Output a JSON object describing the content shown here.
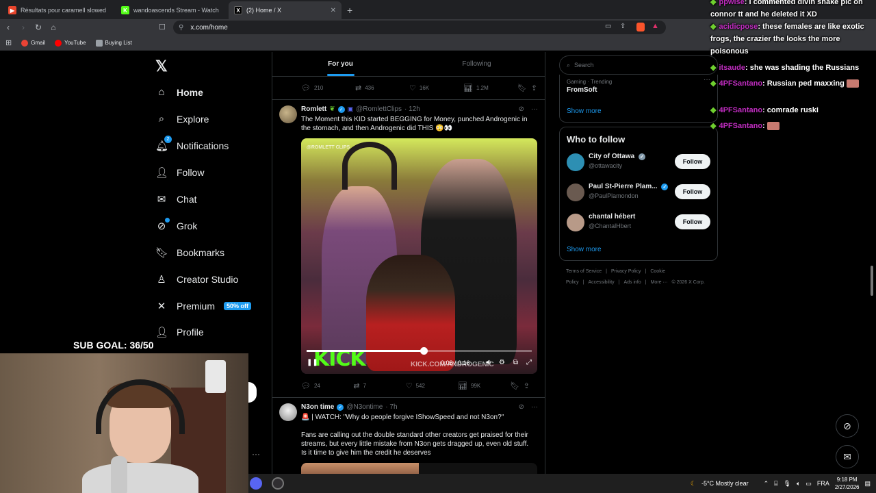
{
  "browser": {
    "tabs": [
      {
        "title": "Résultats pour caramell slowed reverb",
        "icon_color": "#e8452c",
        "icon": "youtube-icon",
        "active": false
      },
      {
        "title": "wandoascends Stream - Watch Live on Kick",
        "icon_color": "#53fc18",
        "icon": "kick-icon",
        "active": false
      },
      {
        "title": "(2) Home / X",
        "icon_color": "#000000",
        "icon": "x-icon",
        "active": true
      }
    ],
    "new_tab": "+",
    "url": "x.com/home",
    "bookmarks": [
      {
        "label": "Gmail",
        "color": "#ea4335"
      },
      {
        "label": "YouTube",
        "color": "#ff0000"
      },
      {
        "label": "Buying List",
        "color": "#9aa0a6"
      }
    ]
  },
  "nav": {
    "items": [
      {
        "label": "Home",
        "icon": "home-icon",
        "glyph": "⌂",
        "bold": true
      },
      {
        "label": "Explore",
        "icon": "search-icon",
        "glyph": "⌕"
      },
      {
        "label": "Notifications",
        "icon": "bell-icon",
        "glyph": "🔔︎",
        "badge": "2"
      },
      {
        "label": "Follow",
        "icon": "add-person-icon",
        "glyph": "👤︎"
      },
      {
        "label": "Chat",
        "icon": "mail-icon",
        "glyph": "✉"
      },
      {
        "label": "Grok",
        "icon": "grok-icon",
        "glyph": "⊘",
        "dot": true
      },
      {
        "label": "Bookmarks",
        "icon": "bookmark-icon",
        "glyph": "🔖︎"
      },
      {
        "label": "Creator Studio",
        "icon": "creator-icon",
        "glyph": "♙"
      },
      {
        "label": "Premium",
        "icon": "x-premium-icon",
        "glyph": "✕",
        "promo": "50% off"
      },
      {
        "label": "Profile",
        "icon": "profile-icon",
        "glyph": "👤︎"
      }
    ]
  },
  "timeline": {
    "tabs": [
      "For you",
      "Following"
    ],
    "prev_actions": {
      "replies": "210",
      "reposts": "436",
      "likes": "16K",
      "views": "1.2M"
    },
    "post1": {
      "name": "Romlett",
      "handle": "@RomlettClips",
      "time": "· 12h",
      "text": "The Moment this KID started BEGGING for Money, punched Androgenic in the stomach, and then Androgenic did THIS 😳👀",
      "video": {
        "watermark": "@ROMLETT CLIPS",
        "logo": "KICK",
        "url_overlay": "KICK.COM/ANDROGENIC",
        "time": "0:08 / 0:16",
        "progress": 0.52
      },
      "actions": {
        "replies": "24",
        "reposts": "7",
        "likes": "542",
        "views": "99K"
      }
    },
    "post2": {
      "name": "N3on time",
      "handle": "@N3ontime",
      "time": "· 7h",
      "line1": "🚨 | WATCH: \"Why do people forgive IShowSpeed and not N3on?\"",
      "line2": "Fans are calling out the double standard other creators get praised for their streams, but every little mistake from N3on gets dragged up, even old stuff. Is it time to give him the credit he deserves"
    }
  },
  "sidebar": {
    "search_placeholder": "Search",
    "trend": {
      "meta": "Gaming · Trending",
      "name": "FromSoft"
    },
    "show_more": "Show more",
    "wtf_title": "Who to follow",
    "follow_label": "Follow",
    "who_to_follow": [
      {
        "name": "City of Ottawa",
        "handle": "@ottawacity",
        "verified_color": "#829aab",
        "avatar_color": "#2d8fb3"
      },
      {
        "name": "Paul St-Pierre Plam...",
        "handle": "@PaulPlamondon",
        "verified_color": "#1d9bf0",
        "avatar_color": "#6a5a50"
      },
      {
        "name": "chantal hébert",
        "handle": "@ChantalHbert",
        "verified_color": null,
        "avatar_color": "#b89a88"
      }
    ],
    "footer": [
      "Terms of Service",
      "|",
      "Privacy Policy",
      "|",
      "Cookie Policy",
      "|",
      "Accessibility",
      "|",
      "Ads info",
      "|",
      "More ···",
      "© 2026 X Corp."
    ]
  },
  "stream_overlay": {
    "chat": [
      {
        "user": "ppwise",
        "msg": ": I commented divin snake pic on connor tt and he deleted it XD"
      },
      {
        "user": "acidicpose",
        "msg": ": these females are like exotic frogs, the crazier the looks the more poisonous"
      },
      {
        "user": "itsaude",
        "msg": ": she was shading the Russians"
      },
      {
        "user": "4PFSantano",
        "msg": ": Russian ped maxxing"
      },
      {
        "user": "4PFSantano",
        "msg": ": comrade ruski"
      },
      {
        "user": "4PFSantano",
        "msg": ":"
      }
    ],
    "sub_goal": "SUB GOAL: 36/50"
  },
  "taskbar": {
    "weather": "-5°C  Mostly clear",
    "lang": "FRA",
    "time": "9:18 PM",
    "date": "2/27/2026"
  }
}
